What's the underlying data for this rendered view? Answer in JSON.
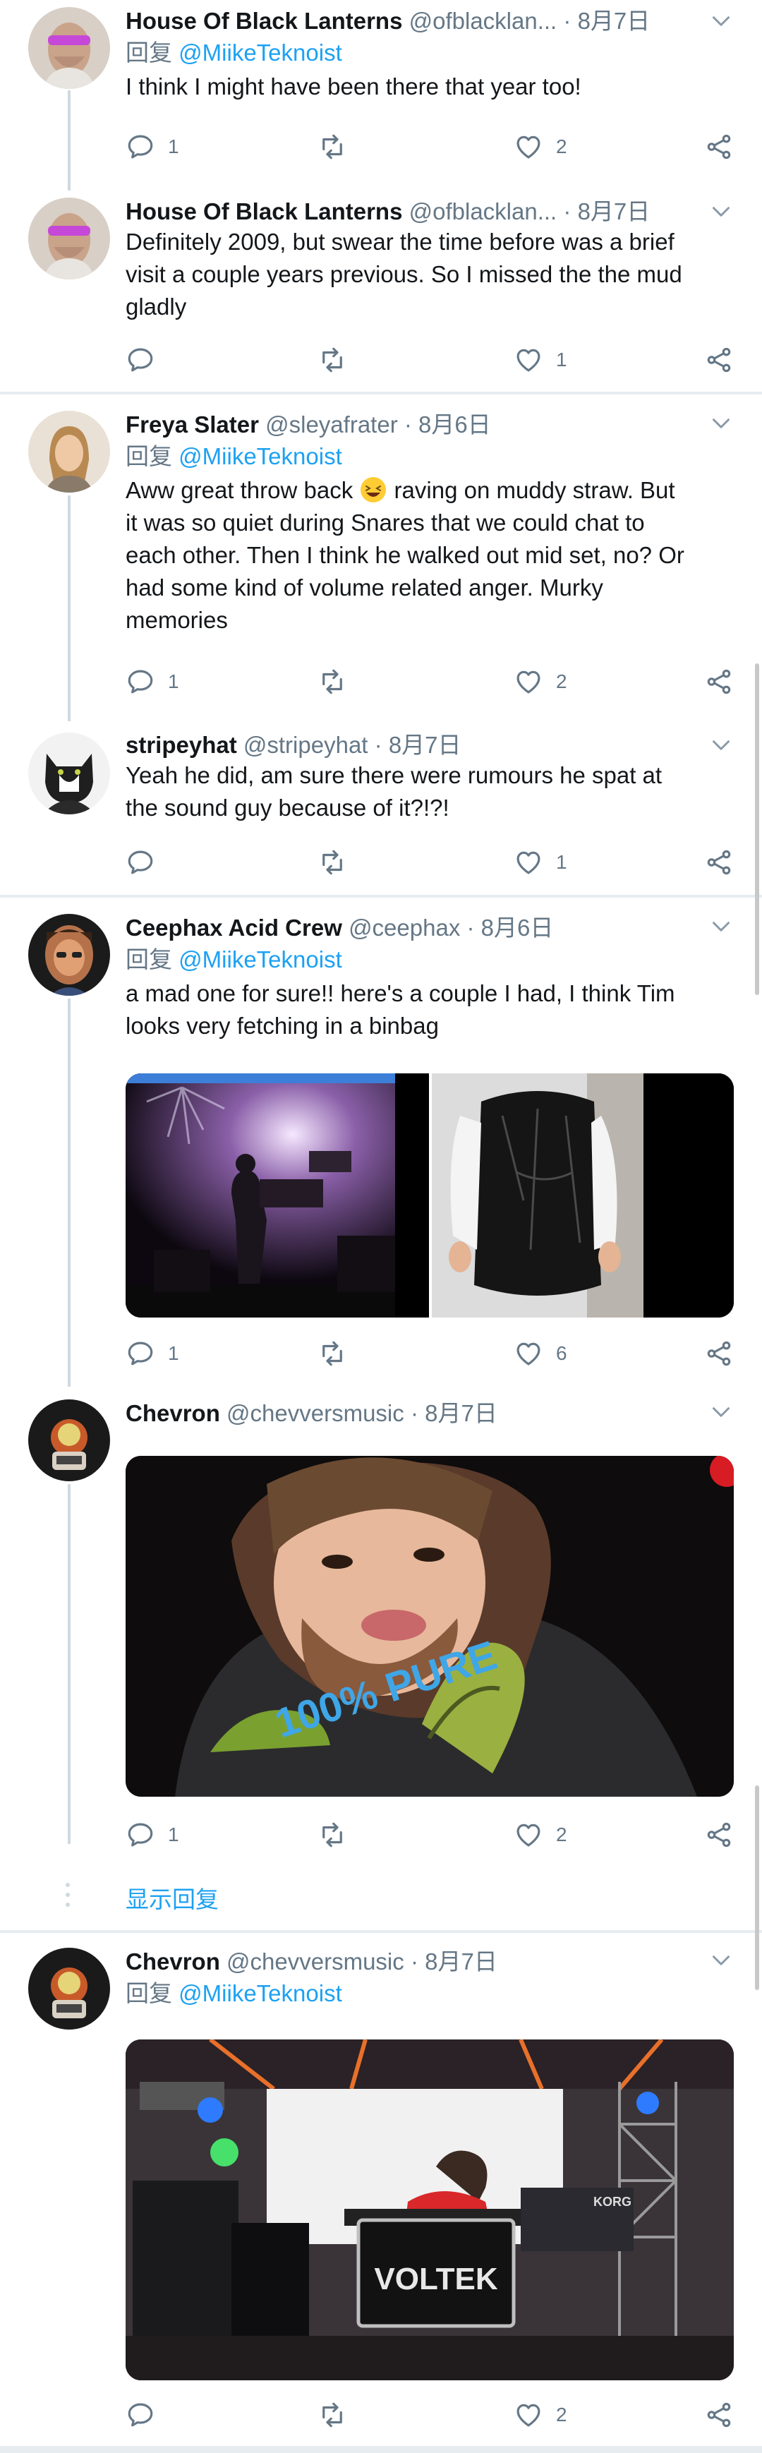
{
  "tweets": [
    {
      "name": "House Of Black Lanterns",
      "handle": "@ofblacklan...",
      "time": "8月7日",
      "reply_prefix": "回复",
      "reply_mention": "@MiikeTeknoist",
      "lines": [
        "I think I might have been there that year too!"
      ],
      "reply_count": "1",
      "like_count": "2"
    },
    {
      "name": "House Of Black Lanterns",
      "handle": "@ofblacklan...",
      "time": "8月7日",
      "lines": [
        "Definitely 2009, but swear the time before was a brief",
        "visit a couple years previous. So I missed the the mud",
        "gladly"
      ],
      "reply_count": "",
      "like_count": "1"
    },
    {
      "name": "Freya Slater",
      "handle": "@sleyafrater",
      "time": "8月6日",
      "reply_prefix": "回复",
      "reply_mention": "@MiikeTeknoist",
      "line1_before_emoji": "Aww great throw back",
      "line1_after_emoji": "raving on muddy straw. But",
      "lines": [
        "it was so quiet during Snares that we could chat to",
        "each other. Then I think he walked out mid set, no? Or",
        "had some kind of volume related anger. Murky",
        "memories"
      ],
      "reply_count": "1",
      "like_count": "2"
    },
    {
      "name": "stripeyhat",
      "handle": "@stripeyhat",
      "time": "8月7日",
      "lines": [
        "Yeah he did, am sure there were rumours he spat at",
        "the sound guy because of it?!?!"
      ],
      "reply_count": "",
      "like_count": "1"
    },
    {
      "name": "Ceephax Acid Crew",
      "handle": "@ceephax",
      "time": "8月6日",
      "reply_prefix": "回复",
      "reply_mention": "@MiikeTeknoist",
      "lines": [
        "a mad one for sure!! here's a couple I had, I think Tim",
        "looks very fetching in a binbag"
      ],
      "reply_count": "1",
      "like_count": "6"
    },
    {
      "name": "Chevron",
      "handle": "@chevversmusic",
      "time": "8月7日",
      "photo_tshirt_text": "100% PURE",
      "reply_count": "1",
      "like_count": "2"
    },
    {
      "name": "Chevron",
      "handle": "@chevversmusic",
      "time": "8月7日",
      "reply_prefix": "回复",
      "reply_mention": "@MiikeTeknoist",
      "photo_case_text": "VOLTEK",
      "photo_keyboard_text": "KORG",
      "reply_count": "",
      "like_count": "2"
    }
  ],
  "show_replies": "显示回复",
  "colors": {
    "accent": "#1da1f2",
    "secondary": "#657786",
    "divider": "#e6ecf0"
  },
  "icons": [
    "reply-icon",
    "retweet-icon",
    "like-icon",
    "share-icon",
    "chevron-down-icon"
  ]
}
